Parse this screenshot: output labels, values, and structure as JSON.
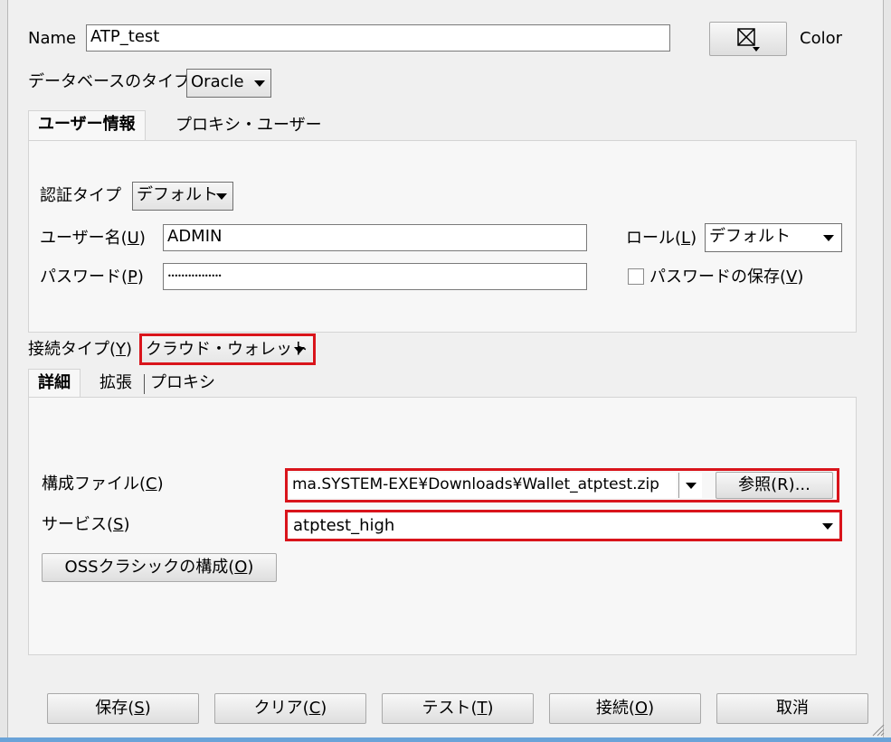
{
  "header": {
    "name_label": "Name",
    "name_value": "ATP_test",
    "color_label": "Color",
    "dbtype_label": "データベースのタイプ",
    "dbtype_value": "Oracle"
  },
  "tabs_top": [
    "ユーザー情報",
    "プロキシ・ユーザー"
  ],
  "user_info": {
    "auth_label": "認証タイプ",
    "auth_value": "デフォルト",
    "username_label": "ユーザー名(",
    "username_mnemonic": "U",
    "username_value": "ADMIN",
    "password_label": "パスワード(",
    "password_mnemonic": "P",
    "password_value": "••••••••••••••••",
    "role_label": "ロール(",
    "role_mnemonic": "L",
    "role_value": "デフォルト",
    "save_password_label": "パスワードの保存(",
    "save_password_mnemonic": "V"
  },
  "connection": {
    "type_label": "接続タイプ(",
    "type_mnemonic": "Y",
    "type_value": "クラウド・ウォレット",
    "tabs": [
      "詳細",
      "拡張",
      "プロキシ"
    ],
    "config_label": "構成ファイル(",
    "config_mnemonic": "C",
    "config_value": "ma.SYSTEM-EXE¥Downloads¥Wallet_atptest.zip",
    "browse_label": "参照(R)...",
    "service_label": "サービス(",
    "service_mnemonic": "S",
    "service_value": "atptest_high",
    "oss_label": "OSSクラシックの構成(",
    "oss_mnemonic": "O"
  },
  "footer": {
    "buttons": [
      {
        "label": "保存(",
        "mnemonic": "S"
      },
      {
        "label": "クリア(",
        "mnemonic": "C"
      },
      {
        "label": "テスト(",
        "mnemonic": "T"
      },
      {
        "label": "接続(",
        "mnemonic": "O"
      },
      {
        "label": "取消",
        "mnemonic": ""
      }
    ]
  },
  "colors": {
    "highlight": "#d9141b",
    "panel": "#f7f7f7",
    "window": "#f0f0f0"
  }
}
